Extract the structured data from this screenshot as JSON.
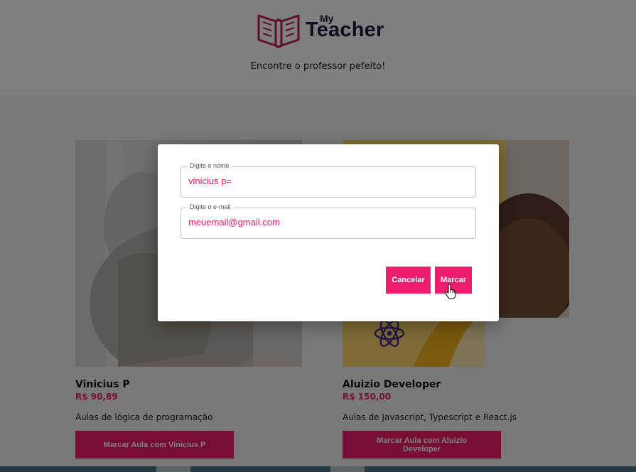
{
  "header": {
    "logo_my": "My",
    "logo_teacher": "Teacher",
    "tagline": "Encontre o professor pefeito!"
  },
  "teachers": [
    {
      "name": "Vinicius P",
      "price": "R$ 90,89",
      "description": "Aulas de lógica de programação",
      "button_label": "Marcar Aula com Vinicius P"
    },
    {
      "name": "Aluizio Developer",
      "price": "R$ 150,00",
      "description": "Aulas de Javascript, Typescript e React.js",
      "button_label": "Marcar Aula com Aluizio Developer"
    }
  ],
  "dialog": {
    "name_label": "Digite o nome",
    "name_value": "vinicius p=",
    "email_label": "Digite o e-mail",
    "email_value": "meuemail@gmail.com",
    "cancel_label": "Cancelar",
    "confirm_label": "Marcar"
  },
  "colors": {
    "brand": "#f01d6e",
    "logo_dark": "#141c3a",
    "logo_book": "#c2185b"
  }
}
